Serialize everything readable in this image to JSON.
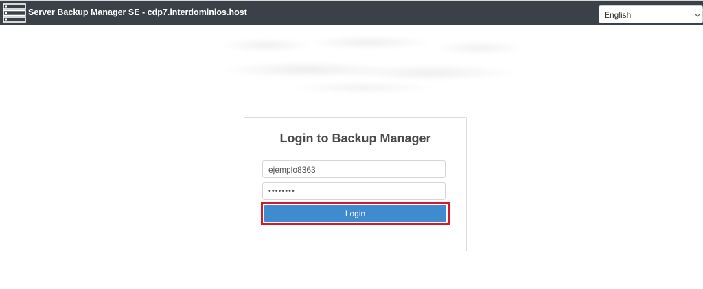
{
  "header": {
    "title": "Server Backup Manager SE - cdp7.interdominios.host",
    "logo_icon": "server-rack-icon",
    "language_selected": "English"
  },
  "login": {
    "heading": "Login to Backup Manager",
    "username_value": "ejemplo8363",
    "password_value": "••••••••",
    "submit_label": "Login"
  },
  "colors": {
    "topbar": "#3a4149",
    "primary_button": "#3f8bd0",
    "highlight": "#d6192a"
  }
}
